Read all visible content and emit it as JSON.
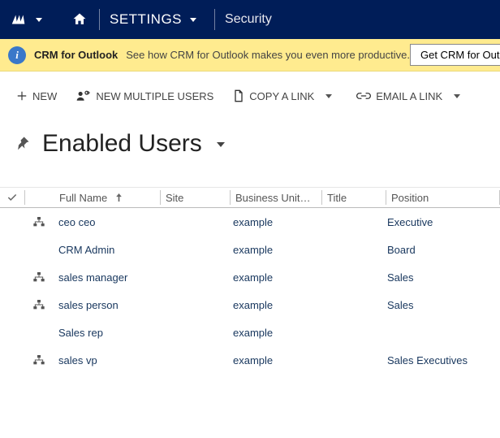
{
  "nav": {
    "settings_label": "SETTINGS",
    "security_label": "Security"
  },
  "banner": {
    "title": "CRM for Outlook",
    "text": "See how CRM for Outlook makes you even more productive.",
    "button_label": "Get CRM for Outlook"
  },
  "commands": {
    "new": "NEW",
    "new_multiple": "NEW MULTIPLE USERS",
    "copy_link": "COPY A LINK",
    "email_link": "EMAIL A LINK"
  },
  "page": {
    "title": "Enabled Users"
  },
  "columns": {
    "full_name": "Full Name",
    "site": "Site",
    "business_unit": "Business Unit…",
    "title": "Title",
    "position": "Position"
  },
  "rows": [
    {
      "has_hier": true,
      "full_name": "ceo ceo",
      "site": "",
      "business_unit": "example",
      "title": "",
      "position": "Executive"
    },
    {
      "has_hier": false,
      "full_name": "CRM Admin",
      "site": "",
      "business_unit": "example",
      "title": "",
      "position": "Board"
    },
    {
      "has_hier": true,
      "full_name": "sales manager",
      "site": "",
      "business_unit": "example",
      "title": "",
      "position": "Sales"
    },
    {
      "has_hier": true,
      "full_name": "sales person",
      "site": "",
      "business_unit": "example",
      "title": "",
      "position": "Sales"
    },
    {
      "has_hier": false,
      "full_name": "Sales rep",
      "site": "",
      "business_unit": "example",
      "title": "",
      "position": ""
    },
    {
      "has_hier": true,
      "full_name": "sales vp",
      "site": "",
      "business_unit": "example",
      "title": "",
      "position": "Sales Executives"
    }
  ]
}
